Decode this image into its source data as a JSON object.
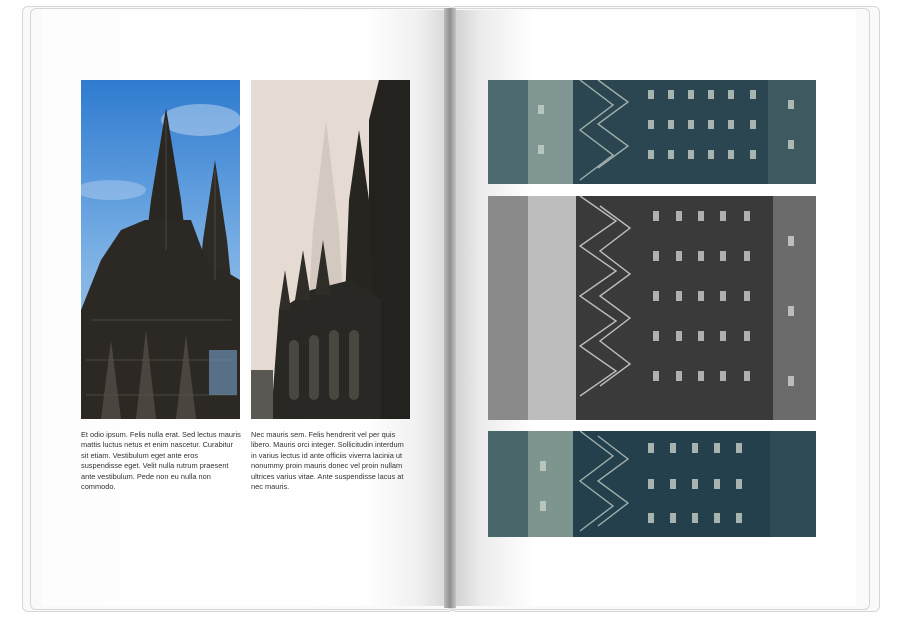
{
  "left_page": {
    "caption_left": "Et odio ipsum. Felis nulla erat. Sed lectus mauris mattis luctus netus et enim nascetur. Curabitur sit etiam. Vestibulum eget ante eros suspendisse eget. Velit nulla rutrum praesent ante vestibulum. Pede non eu nulla non commodo.",
    "caption_right": "Nec mauris sem. Felis hendrerit vel per quis libero. Mauris orci integer. Sollicitudin interdum in varius lectus id ante officiis viverra lacinia ut nonummy proin mauris donec vel proin nullam ultrices varius vitae. Ante suspendisse lacus at nec mauris."
  },
  "colors": {
    "sky": "#3d88d6",
    "fog": "#e6dbd2",
    "teal": "#2f4a55",
    "stone": "#2b2a27"
  }
}
